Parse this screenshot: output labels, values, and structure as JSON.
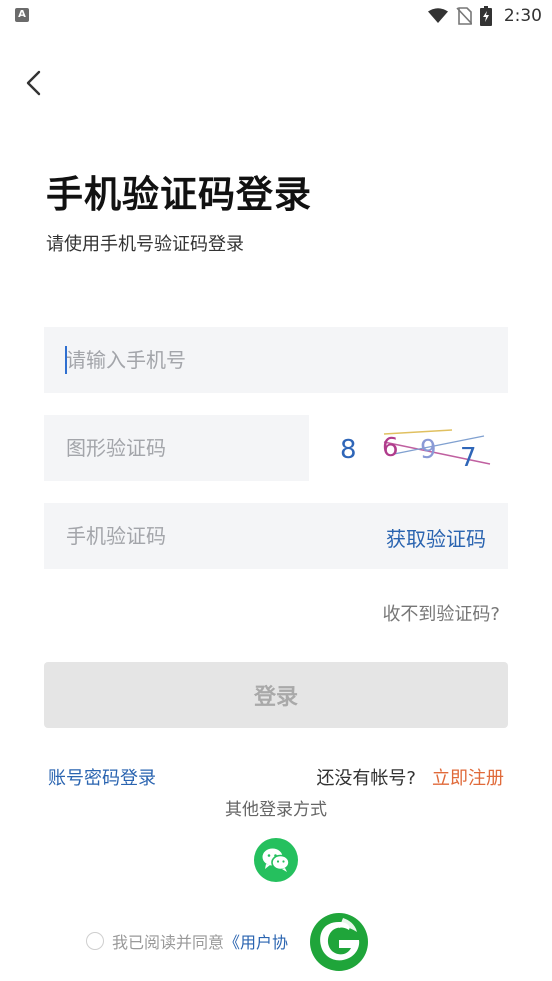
{
  "status_bar": {
    "app_icon_letter": "A",
    "time": "2:30",
    "icons": [
      "wifi-icon",
      "no-sim-icon",
      "battery-charging-icon"
    ]
  },
  "header": {
    "title": "手机验证码登录",
    "subtitle": "请使用手机号验证码登录"
  },
  "form": {
    "phone_placeholder": "请输入手机号",
    "captcha_placeholder": "图形验证码",
    "captcha_digits": [
      "8",
      "6",
      "9",
      "7"
    ],
    "sms_placeholder": "手机验证码",
    "get_code_label": "获取验证码",
    "no_code_label": "收不到验证码?",
    "login_label": "登录"
  },
  "links": {
    "password_login": "账号密码登录",
    "no_account": "还没有帐号?",
    "register": "立即注册",
    "other_login": "其他登录方式"
  },
  "agreement": {
    "text": "我已阅读并同意",
    "link": "《用户协"
  },
  "colors": {
    "accent_blue": "#2a64b0",
    "register_orange": "#e06a3a",
    "wechat_green": "#25c05e",
    "field_bg": "#f4f5f7"
  }
}
